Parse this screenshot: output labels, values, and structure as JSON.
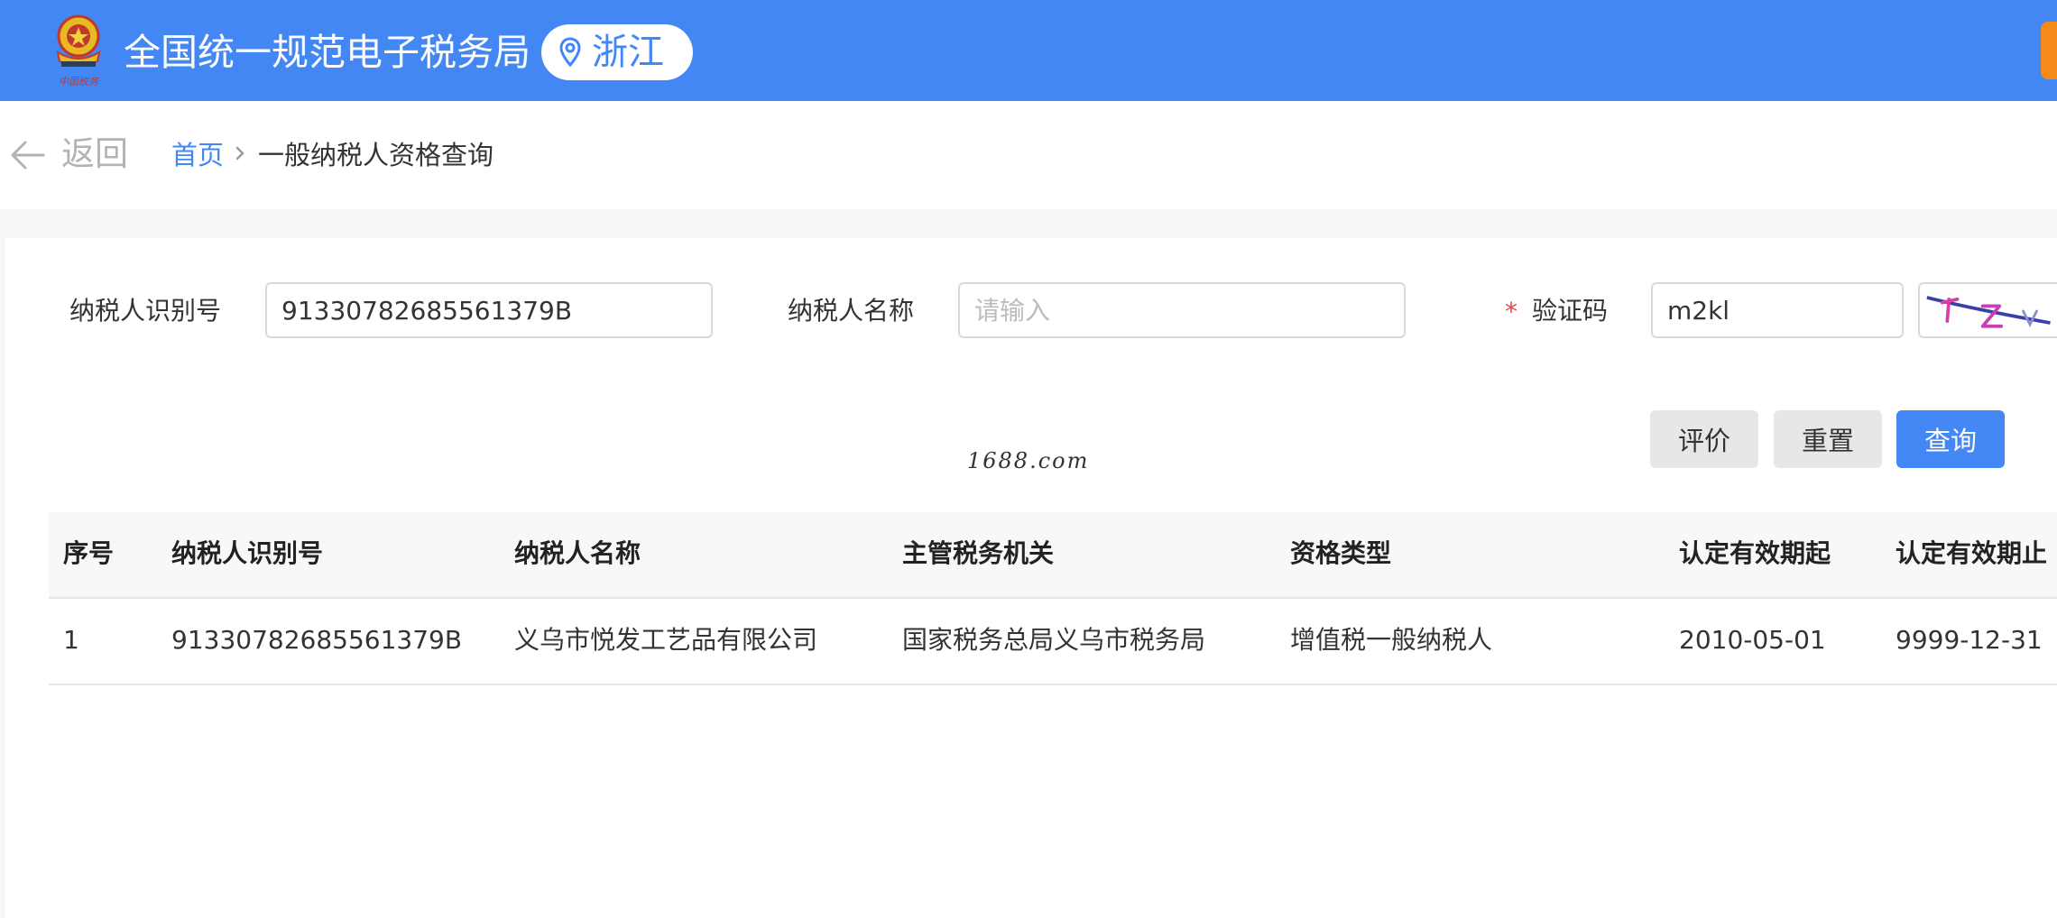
{
  "header": {
    "title": "全国统一规范电子税务局",
    "region": "浙江",
    "emblem_text": "中国税务",
    "color": "#4387f4",
    "emblem_icon": "tax-emblem-icon",
    "region_icon": "location-pin-icon"
  },
  "breadcrumb": {
    "back_label": "返回",
    "home": "首页",
    "current": "一般纳税人资格查询",
    "back_icon": "arrow-left-icon",
    "separator_icon": "chevron-right-icon"
  },
  "form": {
    "tin_label": "纳税人识别号",
    "tin_value": "91330782685561379B",
    "name_label": "纳税人名称",
    "name_placeholder": "请输入",
    "captcha_label": "验证码",
    "required_mark": "*",
    "captcha_value": "m2kl"
  },
  "buttons": {
    "rate": "评价",
    "reset": "重置",
    "query": "查询",
    "primary_color": "#4387f4"
  },
  "watermark": "1688.com",
  "table": {
    "columns": [
      "序号",
      "纳税人识别号",
      "纳税人名称",
      "主管税务机关",
      "资格类型",
      "认定有效期起",
      "认定有效期止"
    ],
    "rows": [
      [
        "1",
        "91330782685561379B",
        "义乌市悦发工艺品有限公司",
        "国家税务总局义乌市税务局",
        "增值税一般纳税人",
        "2010-05-01",
        "9999-12-31"
      ]
    ]
  }
}
